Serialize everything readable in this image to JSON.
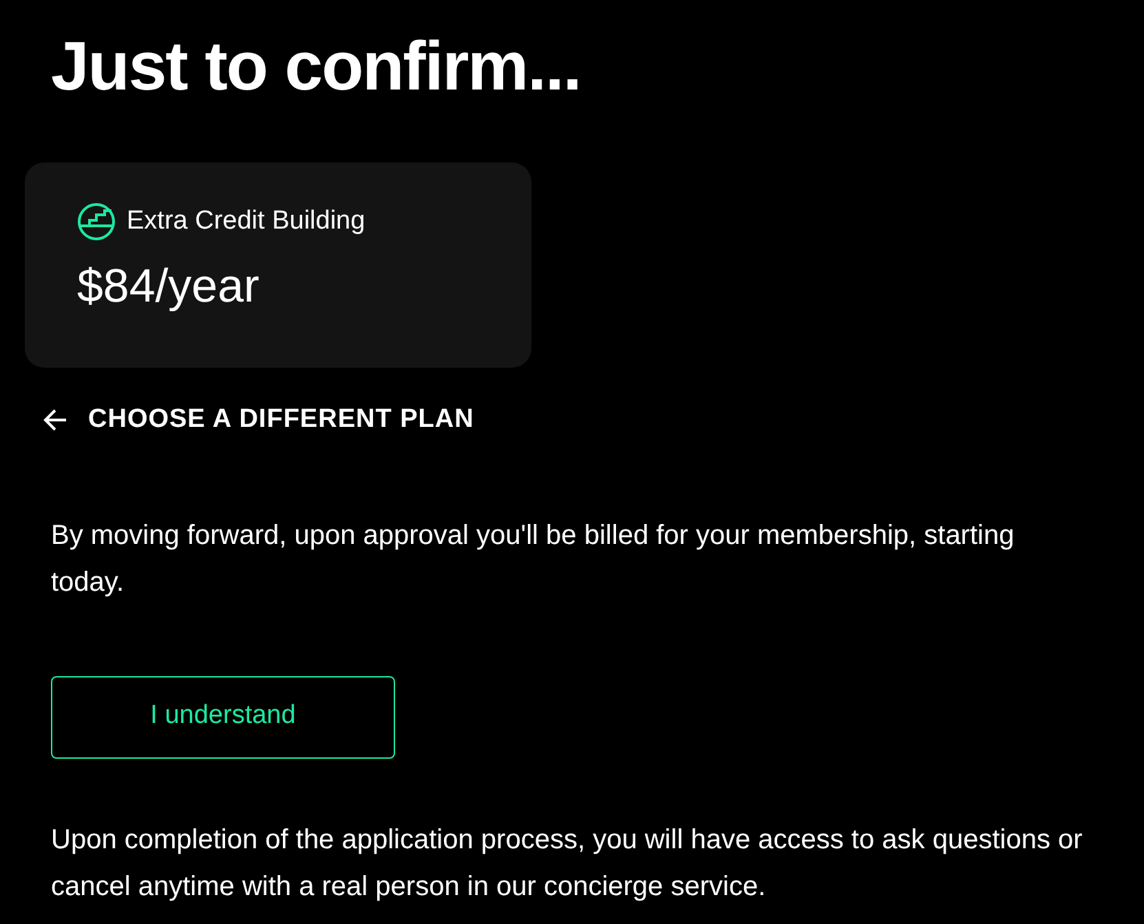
{
  "heading": "Just to confirm...",
  "plan": {
    "name": "Extra Credit Building",
    "price": "$84/year"
  },
  "back_link": "CHOOSE A DIFFERENT PLAN",
  "notice": "By moving forward, upon approval you'll be billed for your membership, starting today.",
  "confirm_button": "I understand",
  "footer_text": "Upon completion of the application process, you will have access to ask questions or cancel anytime with a real person in our concierge service."
}
